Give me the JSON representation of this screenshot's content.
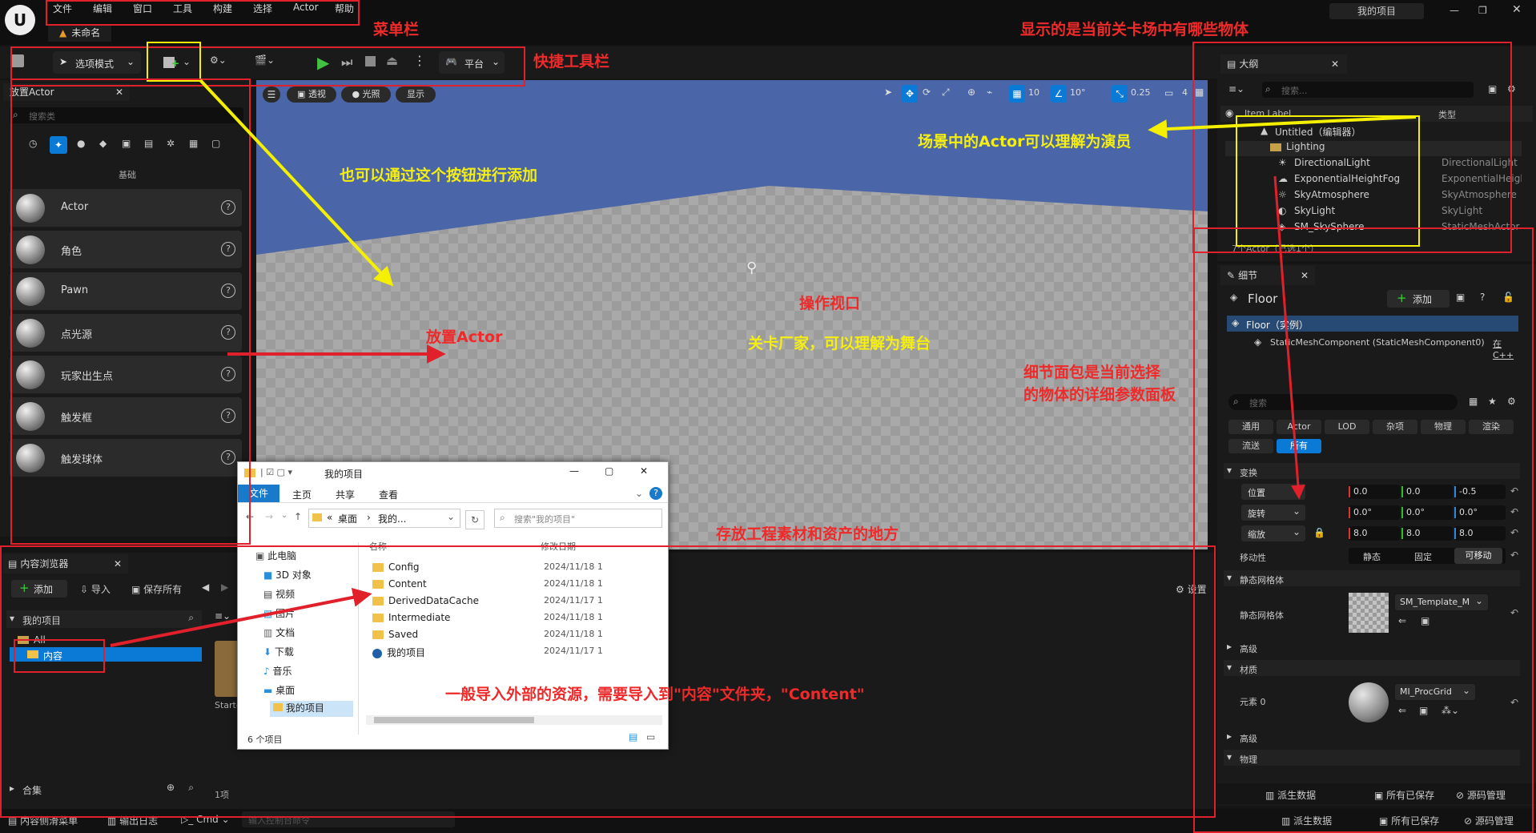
{
  "app": {
    "menu": [
      "文件",
      "编辑",
      "窗口",
      "工具",
      "构建",
      "选择",
      "Actor",
      "帮助"
    ],
    "level_tab": "未命名",
    "project_name": "我的项目"
  },
  "toolbar": {
    "mode": "选项模式",
    "platform": "平台"
  },
  "place_actors": {
    "tab": "放置Actor",
    "search_placeholder": "搜索类",
    "category": "基础",
    "items": [
      "Actor",
      "角色",
      "Pawn",
      "点光源",
      "玩家出生点",
      "触发框",
      "触发球体"
    ]
  },
  "viewport": {
    "perspective": "透视",
    "lighting": "光照",
    "show": "显示",
    "grid_snap": "10",
    "angle_snap": "10°",
    "scale_snap": "0.25",
    "camera_speed": "4"
  },
  "outliner": {
    "tab": "大纲",
    "search_placeholder": "搜索...",
    "col_label": "Item Label",
    "col_type": "类型",
    "root": "Untitled（编辑器）",
    "folder": "Lighting",
    "items": [
      {
        "name": "DirectionalLight",
        "type": "DirectionalLight"
      },
      {
        "name": "ExponentialHeightFog",
        "type": "ExponentialHeightFog"
      },
      {
        "name": "SkyAtmosphere",
        "type": "SkyAtmosphere"
      },
      {
        "name": "SkyLight",
        "type": "SkyLight"
      },
      {
        "name": "SM_SkySphere",
        "type": "StaticMeshActor"
      }
    ],
    "footer": "7个Actor（已选1个）"
  },
  "details": {
    "tab": "细节",
    "object": "Floor",
    "add": "添加",
    "instance": "Floor（实例）",
    "component": "StaticMeshComponent (StaticMeshComponent0)",
    "component_link": "在C++",
    "search_placeholder": "搜索",
    "filters_row1": [
      "通用",
      "Actor",
      "LOD",
      "杂项",
      "物理",
      "渲染"
    ],
    "filters_row2": [
      "流送",
      "所有"
    ],
    "transform_section": "变换",
    "location": {
      "label": "位置",
      "x": "0.0",
      "y": "0.0",
      "z": "-0.5"
    },
    "rotation": {
      "label": "旋转",
      "x": "0.0°",
      "y": "0.0°",
      "z": "0.0°"
    },
    "scale": {
      "label": "缩放",
      "x": "8.0",
      "y": "8.0",
      "z": "8.0"
    },
    "mobility_label": "移动性",
    "mobility_options": [
      "静态",
      "固定",
      "可移动"
    ],
    "static_mesh_section": "静态网格体",
    "static_mesh_label": "静态网格体",
    "static_mesh_value": "SM_Template_M",
    "advanced": "高级",
    "materials_section": "材质",
    "element_label": "元素 0",
    "material_value": "MI_ProcGrid",
    "advanced2": "高级",
    "physics_section": "物理"
  },
  "content_browser": {
    "tab": "内容浏览器",
    "add": "添加",
    "import": "导入",
    "save_all": "保存所有",
    "settings": "设置",
    "project": "我的项目",
    "all": "All",
    "content": "内容",
    "collections": "合集",
    "count": "1项",
    "asset_label": "Starte"
  },
  "explorer": {
    "title": "我的项目",
    "tabs": [
      "文件",
      "主页",
      "共享",
      "查看"
    ],
    "path": [
      "«",
      "桌面",
      "›",
      "我的..."
    ],
    "search_placeholder": "搜索\"我的项目\"",
    "nav": [
      "此电脑",
      "3D 对象",
      "视频",
      "图片",
      "文档",
      "下载",
      "音乐",
      "桌面",
      "我的项目"
    ],
    "col_name": "名称",
    "col_date": "修改日期",
    "files": [
      {
        "name": "Config",
        "date": "2024/11/18 1"
      },
      {
        "name": "Content",
        "date": "2024/11/18 1"
      },
      {
        "name": "DerivedDataCache",
        "date": "2024/11/17 1"
      },
      {
        "name": "Intermediate",
        "date": "2024/11/18 1"
      },
      {
        "name": "Saved",
        "date": "2024/11/18 1"
      },
      {
        "name": "我的项目",
        "date": "2024/11/17 1"
      }
    ],
    "status": "6 个项目"
  },
  "status_bar": {
    "content_drawer": "内容侧滑菜单",
    "output_log": "输出日志",
    "cmd": "Cmd",
    "console_placeholder": "输入控制台命令",
    "derived_data": "派生数据",
    "all_saved": "所有已保存",
    "source_control": "源码管理"
  },
  "annotations": {
    "menu_bar": "菜单栏",
    "quick_toolbar": "快捷工具栏",
    "outliner_note": "显示的是当前关卡场中有哪些物体",
    "add_button_note": "也可以通过这个按钮进行添加",
    "actors_note": "场景中的Actor可以理解为演员",
    "viewport_note": "操作视口",
    "level_note": "关卡厂家，可以理解为舞台",
    "place_actor_note": "放置Actor",
    "details_note_1": "细节面包是当前选择",
    "details_note_2": "的物体的详细参数面板",
    "content_note": "存放工程素材和资产的地方",
    "import_note": "一般导入外部的资源，需要导入到\"内容\"文件夹，\"Content\""
  },
  "colors": {
    "accent_blue": "#0a7ad6",
    "annotation_red": "#e0202a",
    "annotation_yellow": "#f4f000",
    "viewport_sky": "#4a66a8"
  }
}
